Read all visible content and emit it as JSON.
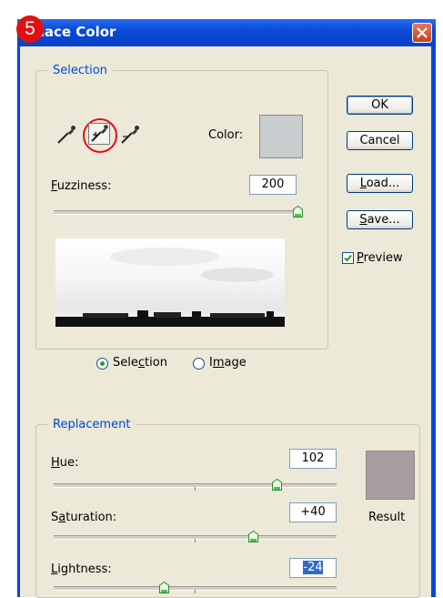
{
  "step_badge": "5",
  "window": {
    "title": "place Color"
  },
  "selection": {
    "legend": "Selection",
    "color_label": "Color:",
    "color_swatch": "#c8cdd0",
    "fuzziness_label": "Fuzziness:",
    "fuzziness_value": "200",
    "fuzziness_level": 200,
    "radio_selection": "Selection",
    "radio_image": "Image",
    "selected_radio": "Selection"
  },
  "buttons": {
    "ok": "OK",
    "cancel": "Cancel",
    "load": "Load...",
    "save": "Save..."
  },
  "preview": {
    "label": "Preview",
    "checked": true
  },
  "replacement": {
    "legend": "Replacement",
    "hue_label": "Hue:",
    "hue_value": "102",
    "saturation_label": "Saturation:",
    "saturation_value": "+40",
    "lightness_label": "Lightness:",
    "lightness_value": "-24",
    "result_label": "Result",
    "result_swatch": "#a89ca3"
  },
  "icons": [
    "eyedropper-icon",
    "eyedropper-plus-icon",
    "eyedropper-minus-icon",
    "close-icon"
  ],
  "highlight_color": "#e01010"
}
